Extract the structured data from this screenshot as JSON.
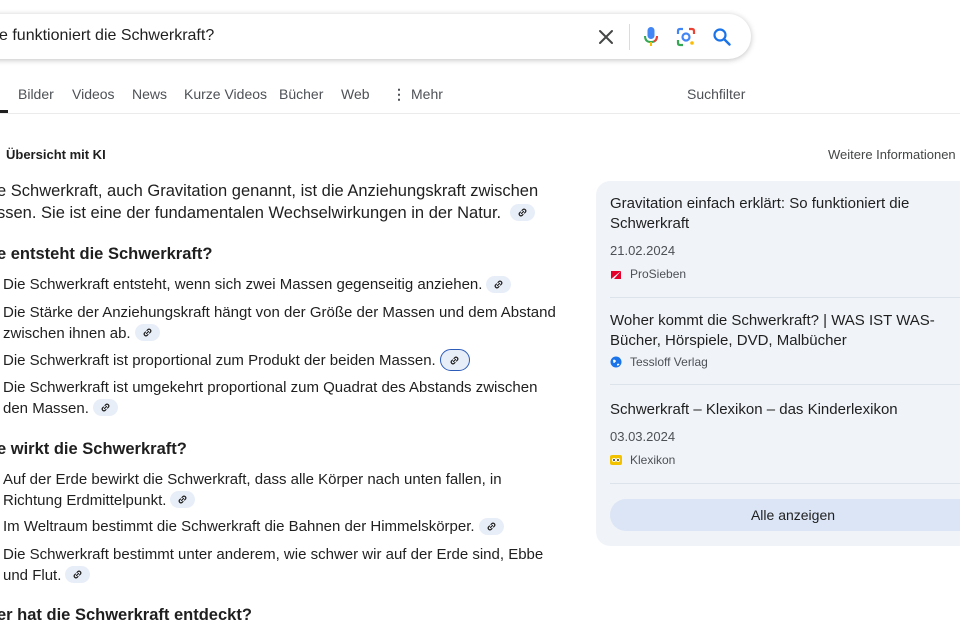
{
  "search": {
    "query": "e funktioniert die Schwerkraft?"
  },
  "tabs": [
    "Bilder",
    "Videos",
    "News",
    "Kurze Videos",
    "Bücher",
    "Web",
    "Mehr"
  ],
  "tools": {
    "label": "Suchfilter"
  },
  "overview": {
    "title": "Übersicht mit KI",
    "more_info": "Weitere Informationen",
    "intro": "e Schwerkraft, auch Gravitation genannt, ist die Anziehungskraft zwischen ssen. Sie ist eine der fundamentalen Wechselwirkungen in der Natur.",
    "intro_line1": "e Schwerkraft, auch Gravitation genannt, ist die Anziehungskraft zwischen",
    "intro_line2": "ssen. Sie ist eine der fundamentalen Wechselwirkungen in der Natur.",
    "sections": [
      {
        "heading": "e entsteht die Schwerkraft?",
        "bullets": [
          "Die Schwerkraft entsteht, wenn sich zwei Massen gegenseitig anziehen.",
          "Die Stärke der Anziehungskraft hängt von der Größe der Massen und dem Abstand zwischen ihnen ab.",
          "Die Schwerkraft ist proportional zum Produkt der beiden Massen.",
          "Die Schwerkraft ist umgekehrt proportional zum Quadrat des Abstands zwischen den Massen."
        ]
      },
      {
        "heading": "e wirkt die Schwerkraft?",
        "bullets": [
          "Auf der Erde bewirkt die Schwerkraft, dass alle Körper nach unten fallen, in Richtung Erdmittelpunkt.",
          "Im Weltraum bestimmt die Schwerkraft die Bahnen der Himmelskörper.",
          "Die Schwerkraft bestimmt unter anderem, wie schwer wir auf der Erde sind, Ebbe und Flut."
        ]
      },
      {
        "heading": "er hat die Schwerkraft entdeckt?"
      }
    ]
  },
  "sources": {
    "items": [
      {
        "title": "Gravitation einfach erklärt: So funktioniert die Schwerkraft",
        "date": "21.02.2024",
        "site": "ProSieben",
        "favicon_color": "#e4002b"
      },
      {
        "title": "Woher kommt die Schwerkraft? | WAS IST WAS-Bücher, Hörspiele, DVD, Malbücher",
        "site": "Tessloff Verlag",
        "favicon_color": "#1a73e8"
      },
      {
        "title": "Schwerkraft – Klexikon – das Kinderlexikon",
        "date": "03.03.2024",
        "site": "Klexikon",
        "favicon_color": "#f2c200"
      }
    ],
    "show_all": "Alle anzeigen"
  },
  "colors": {
    "accent": "#1a73e8",
    "panel": "#f0f4f9",
    "chip": "#e8eef8"
  }
}
